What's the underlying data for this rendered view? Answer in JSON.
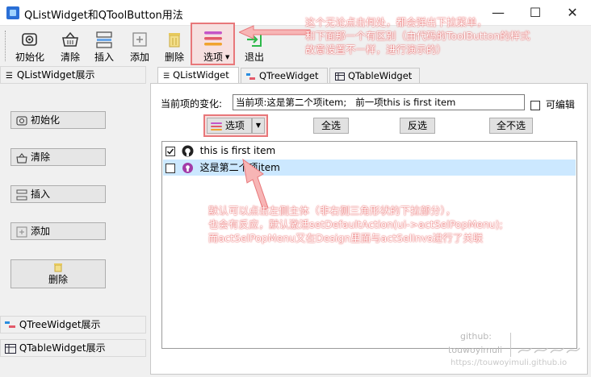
{
  "window": {
    "title": "QListWidget和QToolButton用法",
    "minimize": "—",
    "maximize": "☐",
    "close": "✕"
  },
  "toolbar": {
    "items": [
      {
        "label": "初始化",
        "icon": "init-icon"
      },
      {
        "label": "清除",
        "icon": "basket-icon"
      },
      {
        "label": "插入",
        "icon": "insert-icon"
      },
      {
        "label": "添加",
        "icon": "add-icon"
      },
      {
        "label": "删除",
        "icon": "trash-icon"
      },
      {
        "label": "选项",
        "icon": "hamburger-menu-icon"
      },
      {
        "label": "退出",
        "icon": "exit-icon"
      }
    ]
  },
  "annotations": {
    "top": [
      "这个无论点击何处，都会弹出下拉菜单，",
      "和下面那一个有区别（由代码的ToolButton的样式",
      "故意设置不一样，进行演示的）"
    ],
    "bottom": [
      "默认可以点击左侧主体（非右侧三角形状的下拉部分），",
      "也会有反应，默认激活setDefaultAction(ui->actSelPopMenu);",
      "而actSelPopMenu又在Design里面与actSelInvs进行了关联"
    ]
  },
  "left_panel": {
    "header": "QListWidget展示",
    "buttons": [
      "初始化",
      "清除",
      "插入",
      "添加",
      "删除"
    ],
    "dock_tree": "QTreeWidget展示",
    "dock_table": "QTableWidget展示"
  },
  "tabs": [
    "QListWidget",
    "QTreeWidget",
    "QTableWidget"
  ],
  "current_item": {
    "label": "当前项的变化:",
    "value": "当前项:这是第二个项item;   前一项this is first item"
  },
  "editable": {
    "label": "可编辑",
    "checked": false
  },
  "buttons": {
    "options": "选项",
    "select_all": "全选",
    "invert": "反选",
    "select_none": "全不选"
  },
  "list_items": [
    {
      "text": "this is first item",
      "checked": true,
      "icon": "github-icon"
    },
    {
      "text": "这是第二个项item",
      "checked": false,
      "icon": "purple-badge-icon",
      "selected": true
    }
  ],
  "watermark": {
    "line1": "github:",
    "line2": "touwoyimuli",
    "line3": "https://touwoyimuli.github.io"
  },
  "colors": {
    "accent_red": "#e8777a",
    "selection": "#cce8ff",
    "menu_stripe_1": "#c455c8",
    "menu_stripe_2": "#e35a6a",
    "menu_stripe_3": "#f0a32e",
    "exit_green": "#2db84a"
  }
}
